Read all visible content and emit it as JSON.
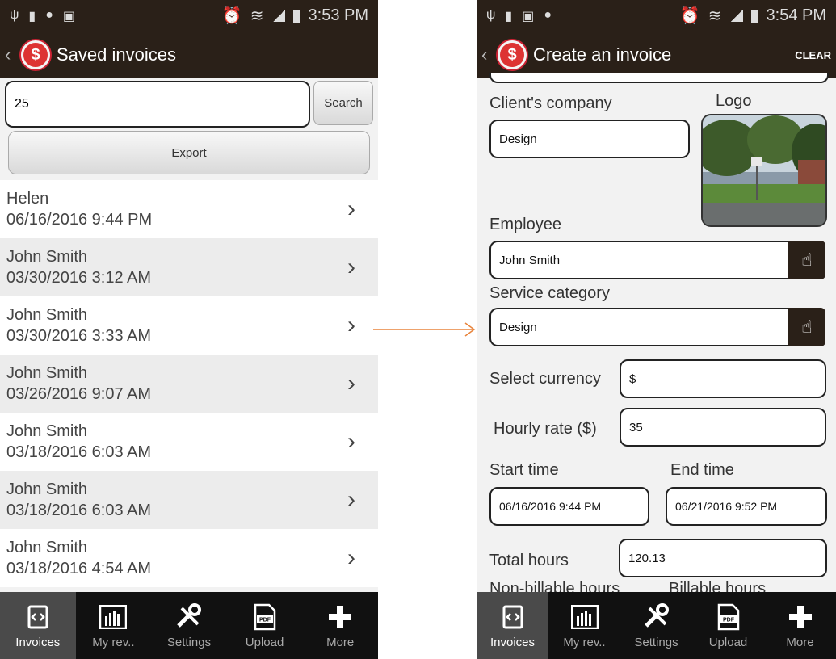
{
  "left": {
    "status_time": "3:53 PM",
    "title": "Saved invoices",
    "search_value": "25",
    "search_button": "Search",
    "export_button": "Export",
    "rows": [
      {
        "name": "Helen",
        "date": "06/16/2016 9:44 PM"
      },
      {
        "name": "John Smith",
        "date": "03/30/2016 3:12 AM"
      },
      {
        "name": "John Smith",
        "date": "03/30/2016 3:33 AM"
      },
      {
        "name": "John Smith",
        "date": "03/26/2016 9:07 AM"
      },
      {
        "name": "John Smith",
        "date": "03/18/2016 6:03 AM"
      },
      {
        "name": "John Smith",
        "date": "03/18/2016 6:03 AM"
      },
      {
        "name": "John Smith",
        "date": "03/18/2016 4:54 AM"
      }
    ]
  },
  "right": {
    "status_time": "3:54 PM",
    "title": "Create an invoice",
    "clear_button": "CLEAR",
    "clients_company_label": "Client's company",
    "clients_company_value": "Design",
    "logo_label": "Logo",
    "employee_label": "Employee",
    "employee_value": "John Smith",
    "service_category_label": "Service category",
    "service_category_value": "Design",
    "select_currency_label": "Select currency",
    "select_currency_value": "$",
    "hourly_rate_label": "Hourly rate ($)",
    "hourly_rate_value": "35",
    "start_time_label": "Start time",
    "start_time_value": "06/16/2016 9:44 PM",
    "end_time_label": "End time",
    "end_time_value": "06/21/2016 9:52 PM",
    "total_hours_label": "Total hours",
    "total_hours_value": "120.13",
    "non_billable_label": "Non-billable hours",
    "billable_label": "Billable hours"
  },
  "nav": {
    "invoices": "Invoices",
    "my_revenue": "My rev..",
    "settings": "Settings",
    "upload": "Upload",
    "more": "More"
  },
  "colors": {
    "bar": "#2a2018",
    "arrow": "#e8843c"
  }
}
